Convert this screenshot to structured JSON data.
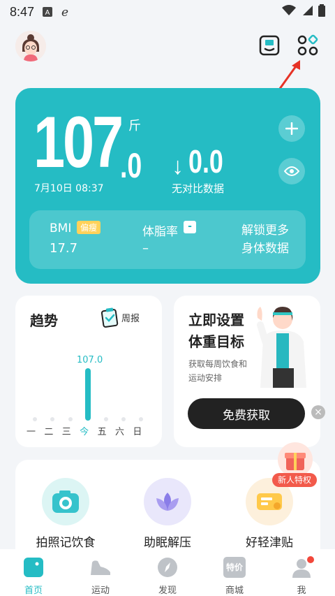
{
  "status_bar": {
    "time": "8:47"
  },
  "weight": {
    "integer": "107",
    "decimal": ".0",
    "unit": "斤",
    "date": "7月10日 08:37"
  },
  "diff": {
    "arrow": "↓",
    "value": "0.0",
    "label": "无对比数据"
  },
  "metrics": {
    "bmi_label": "BMI",
    "bmi_tag": "偏瘦",
    "bmi_value": "17.7",
    "fat_label": "体脂率",
    "fat_tag": "-",
    "fat_value": "–",
    "unlock_line1": "解锁更多",
    "unlock_line2": "身体数据"
  },
  "trend": {
    "title": "趋势",
    "weekly_label": "周报",
    "value_label": "107.0",
    "value": 107.0,
    "days": [
      "一",
      "二",
      "三",
      "今",
      "五",
      "六",
      "日"
    ]
  },
  "goal": {
    "title_line1": "立即设置",
    "title_line2": "体重目标",
    "sub_line1": "获取每周饮食和",
    "sub_line2": "运动安排",
    "button": "免费获取",
    "close": "×"
  },
  "newbie": {
    "label": "新人特权"
  },
  "features": [
    {
      "label": "拍照记饮食",
      "icon": "camera-icon"
    },
    {
      "label": "助眠解压",
      "icon": "lotus-icon"
    },
    {
      "label": "好轻津贴",
      "icon": "coupon-icon"
    }
  ],
  "tabs": [
    {
      "label": "首页",
      "icon": "home-icon",
      "active": true
    },
    {
      "label": "运动",
      "icon": "shoe-icon"
    },
    {
      "label": "发现",
      "icon": "compass-icon"
    },
    {
      "label": "商城",
      "icon": "shop-icon",
      "badge_text": "特价"
    },
    {
      "label": "我",
      "icon": "profile-icon"
    }
  ],
  "colors": {
    "accent": "#25bcc4",
    "tag_yellow": "#ffd25a",
    "red": "#f25a4b"
  }
}
